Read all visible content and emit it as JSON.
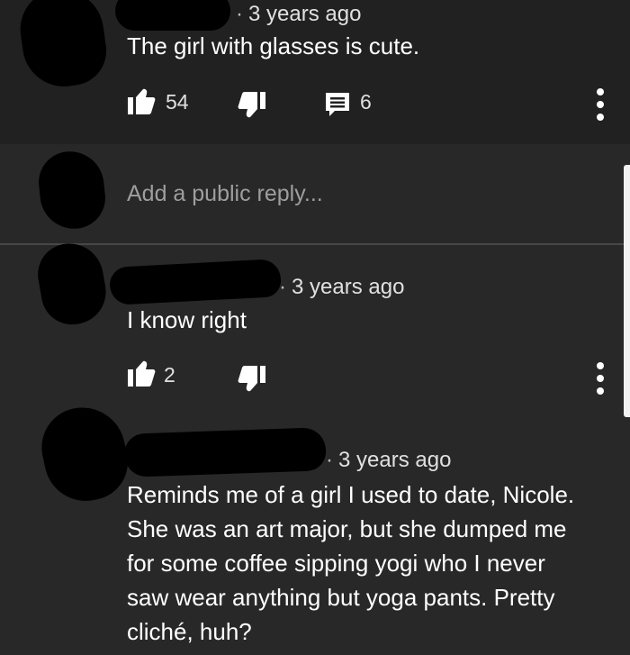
{
  "comment": {
    "timestamp": "3 years ago",
    "text": "The girl with glasses is cute.",
    "likes": "54",
    "replies": "6"
  },
  "reply_box": {
    "placeholder": "Add a public reply..."
  },
  "replies": [
    {
      "timestamp": "3 years ago",
      "text": "I know right",
      "likes": "2"
    },
    {
      "timestamp": "3 years ago",
      "text_lines": [
        "Reminds me of a girl I used to date, Nicole.",
        "She was an art major, but she dumped me",
        "for some coffee sipping yogi who I never",
        "saw wear anything but yoga pants. Pretty",
        "cliché, huh?"
      ]
    }
  ],
  "icons": {
    "like": "thumbs-up-icon",
    "dislike": "thumbs-down-icon",
    "reply": "comment-icon",
    "menu": "more-vert-icon"
  },
  "colors": {
    "background": "#272727",
    "top_band": "#212121",
    "text": "#ffffff",
    "muted": "#9e9e9e",
    "redaction": "#000000"
  }
}
